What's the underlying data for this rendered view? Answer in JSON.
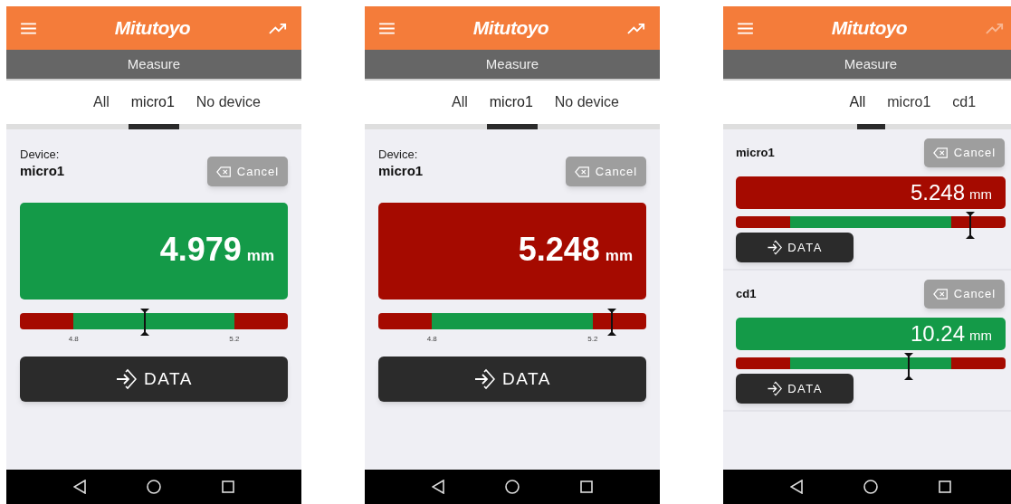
{
  "screens": [
    {
      "kind": "single",
      "header": {
        "logo": "Mitutoyo",
        "trend_enabled": true
      },
      "subtitle": "Measure",
      "tabs": [
        {
          "label": "All",
          "selected": false
        },
        {
          "label": "micro1",
          "selected": true
        },
        {
          "label": "No device",
          "selected": false
        }
      ],
      "devices": [
        {
          "label": "Device:",
          "name": "micro1",
          "cancel": "Cancel",
          "value": "4.979",
          "unit": "mm",
          "color": "#149a48",
          "level": 0.466,
          "ticks": [
            "4.8",
            "5.2"
          ],
          "data_button": "DATA"
        }
      ]
    },
    {
      "kind": "single",
      "header": {
        "logo": "Mitutoyo",
        "trend_enabled": true
      },
      "subtitle": "Measure",
      "tabs": [
        {
          "label": "All",
          "selected": false
        },
        {
          "label": "micro1",
          "selected": true
        },
        {
          "label": "No device",
          "selected": false
        }
      ],
      "devices": [
        {
          "label": "Device:",
          "name": "micro1",
          "cancel": "Cancel",
          "value": "5.248",
          "unit": "mm",
          "color": "#a50a00",
          "level": 0.871,
          "ticks": [
            "4.8",
            "5.2"
          ],
          "data_button": "DATA"
        }
      ]
    },
    {
      "kind": "list",
      "header": {
        "logo": "Mitutoyo",
        "trend_enabled": false
      },
      "subtitle": "Measure",
      "tabs": [
        {
          "label": "All",
          "selected": true
        },
        {
          "label": "micro1",
          "selected": false
        },
        {
          "label": "cd1",
          "selected": false
        }
      ],
      "devices": [
        {
          "name": "micro1",
          "cancel": "Cancel",
          "value": "5.248",
          "unit": "mm",
          "color": "#a50a00",
          "level": 0.87,
          "data_button": "DATA"
        },
        {
          "name": "cd1",
          "cancel": "Cancel",
          "value": "10.24",
          "unit": "mm",
          "color": "#149a48",
          "level": 0.64,
          "data_button": "DATA"
        }
      ]
    }
  ]
}
